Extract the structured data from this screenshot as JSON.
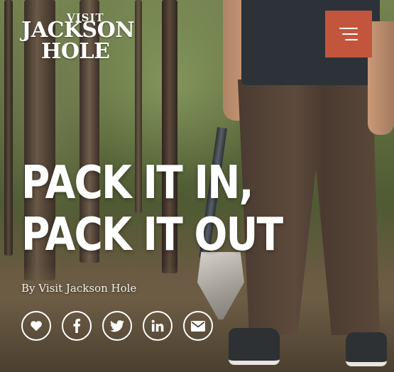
{
  "header": {
    "logo": {
      "line1": "VISIT",
      "line2": "JACKSON",
      "line3": "HOLE"
    },
    "menu_icon": "hamburger-icon",
    "menu_color": "#c3553d"
  },
  "article": {
    "title": "PACK IT IN, PACK IT OUT",
    "byline": "By Visit Jackson Hole"
  },
  "share": {
    "items": [
      {
        "icon": "heart-icon"
      },
      {
        "icon": "facebook-icon"
      },
      {
        "icon": "twitter-icon"
      },
      {
        "icon": "linkedin-icon"
      },
      {
        "icon": "email-icon"
      }
    ]
  }
}
